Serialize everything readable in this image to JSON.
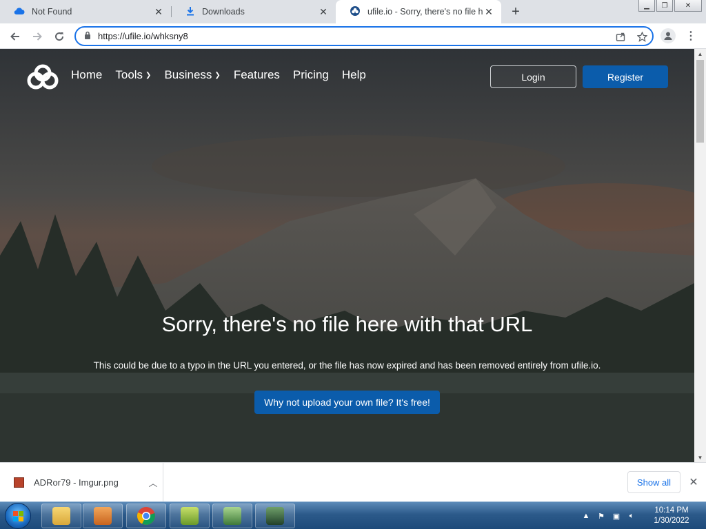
{
  "browser": {
    "tabs": [
      {
        "title": "Not Found",
        "icon": "cloud-icon"
      },
      {
        "title": "Downloads",
        "icon": "download-icon"
      },
      {
        "title": "ufile.io - Sorry, there's no file here",
        "icon": "ufile-logo-icon"
      }
    ],
    "url": "https://ufile.io/whksny8"
  },
  "site": {
    "nav": {
      "home": "Home",
      "tools": "Tools",
      "business": "Business",
      "features": "Features",
      "pricing": "Pricing",
      "help": "Help",
      "login": "Login",
      "register": "Register"
    },
    "hero": {
      "title": "Sorry, there's no file here with that URL",
      "subtitle": "This could be due to a typo in the URL you entered, or the file has now expired and has been removed entirely from ufile.io.",
      "cta": "Why not upload your own file? It's free!"
    },
    "colors": {
      "primary": "#0b5cab",
      "accent": "#1a73e8"
    }
  },
  "download_bar": {
    "file_name": "ADRor79 - Imgur.png",
    "show_all": "Show all"
  },
  "taskbar": {
    "time": "10:14 PM",
    "date": "1/30/2022"
  }
}
